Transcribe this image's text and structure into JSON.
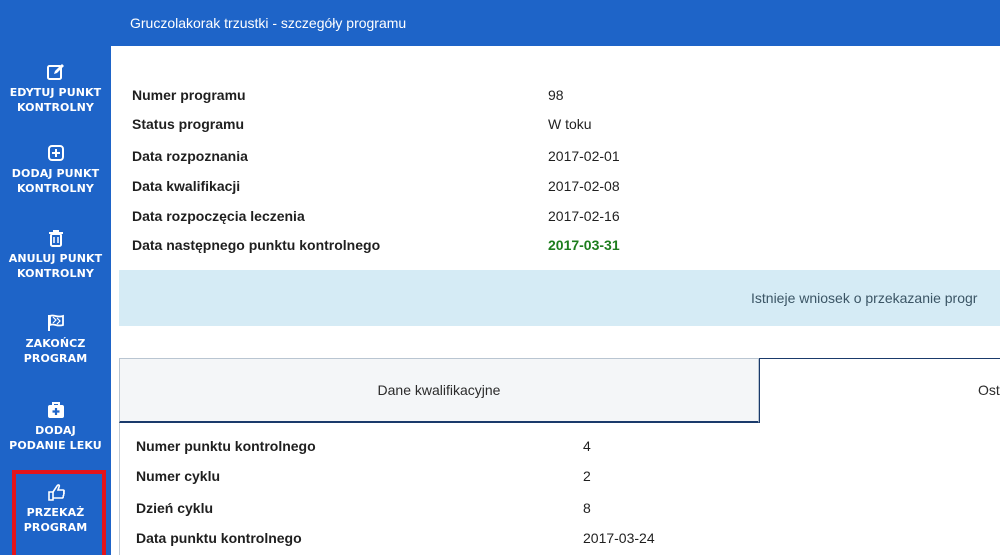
{
  "title_bar": {
    "title": "Gruczolakorak trzustki - szczegóły programu"
  },
  "sidebar": {
    "items": [
      {
        "icon": "edit-icon",
        "line1": "EDYTUJ PUNKT",
        "line2": "KONTROLNY"
      },
      {
        "icon": "plus-square-icon",
        "line1": "DODAJ PUNKT",
        "line2": "KONTROLNY"
      },
      {
        "icon": "trash-icon",
        "line1": "ANULUJ PUNKT",
        "line2": "KONTROLNY"
      },
      {
        "icon": "flag-checkered-icon",
        "line1": "ZAKOŃCZ",
        "line2": "PROGRAM"
      },
      {
        "icon": "medkit-icon",
        "line1": "DODAJ",
        "line2": "PODANIE LEKU"
      },
      {
        "icon": "hand-pointer-icon",
        "line1": "PRZEKAŻ",
        "line2": "PROGRAM"
      }
    ],
    "highlight_color": "#e3141b"
  },
  "program_info": [
    {
      "label": "Numer programu",
      "value": "98"
    },
    {
      "label": "Status programu",
      "value": "W toku"
    },
    {
      "label": "Data rozpoznania",
      "value": "2017-02-01"
    },
    {
      "label": "Data kwalifikacji",
      "value": "2017-02-08"
    },
    {
      "label": "Data rozpoczęcia leczenia",
      "value": "2017-02-16"
    },
    {
      "label": "Data następnego punktu kontrolnego",
      "value": "2017-03-31"
    }
  ],
  "notice": {
    "text": "Istnieje wniosek o przekazanie progr"
  },
  "tabs": [
    {
      "label": "Dane kwalifikacyjne",
      "active": false
    },
    {
      "label": "Ost",
      "active": true
    }
  ],
  "checkpoint": [
    {
      "label": "Numer punktu kontrolnego",
      "value": "4"
    },
    {
      "label": "Numer cyklu",
      "value": "2"
    },
    {
      "label": "Dzień cyklu",
      "value": "8"
    },
    {
      "label": "Data punktu kontrolnego",
      "value": "2017-03-24"
    }
  ],
  "colors": {
    "brand_blue": "#1e64c8",
    "notice_bg": "#d5ebf5",
    "next_date_green": "#1e7d1e"
  }
}
